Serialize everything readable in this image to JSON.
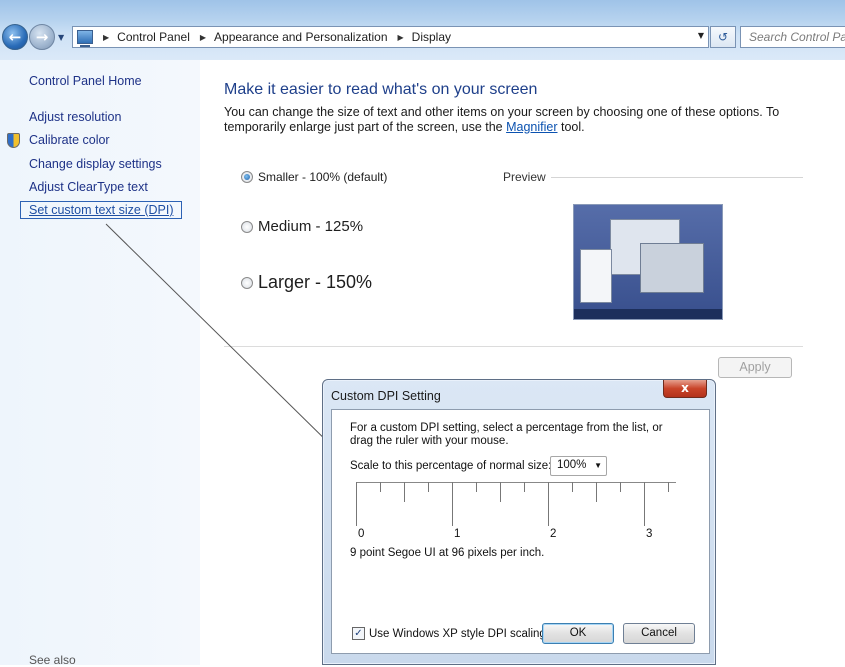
{
  "address_bar": {
    "breadcrumbs": [
      "Control Panel",
      "Appearance and Personalization",
      "Display"
    ],
    "search_placeholder": "Search Control Panel"
  },
  "icons": {
    "back": "back-arrow-icon",
    "forward": "forward-arrow-icon",
    "control_panel": "control-panel-icon",
    "refresh": "refresh-icon",
    "shield": "uac-shield-icon",
    "close": "close-icon",
    "dropdown": "chevron-down-icon"
  },
  "sidebar": {
    "home": "Control Panel Home",
    "items": [
      {
        "label": "Adjust resolution"
      },
      {
        "label": "Calibrate color"
      },
      {
        "label": "Change display settings"
      },
      {
        "label": "Adjust ClearType text"
      },
      {
        "label": "Set custom text size (DPI)",
        "selected": true
      }
    ],
    "see_also": "See also"
  },
  "main": {
    "title": "Make it easier to read what's on your screen",
    "desc_before": "You can change the size of text and other items on your screen by choosing one of these options. To temporarily enlarge just part of the screen, use the ",
    "desc_link": "Magnifier",
    "desc_after": " tool.",
    "options": [
      {
        "label": "Smaller - 100% (default)",
        "checked": true
      },
      {
        "label": "Medium - 125%",
        "checked": false
      },
      {
        "label": "Larger - 150%",
        "checked": false
      }
    ],
    "preview_label": "Preview",
    "apply_label": "Apply"
  },
  "dialog": {
    "title": "Custom DPI Setting",
    "close_label": "x",
    "description": "For a custom DPI setting, select a percentage from the list, or drag the ruler with your mouse.",
    "scale_label": "Scale to this percentage of normal size:",
    "scale_value": "100%",
    "ruler_labels": [
      "0",
      "1",
      "2",
      "3"
    ],
    "font_info": "9 point Segoe UI at 96 pixels per inch.",
    "xp_scaling_label": "Use Windows XP style DPI scaling",
    "xp_scaling_checked": true,
    "ok_label": "OK",
    "cancel_label": "Cancel"
  },
  "colors": {
    "link": "#1e3287",
    "title_blue": "#1e3f8a",
    "close_red": "#c9442a"
  }
}
